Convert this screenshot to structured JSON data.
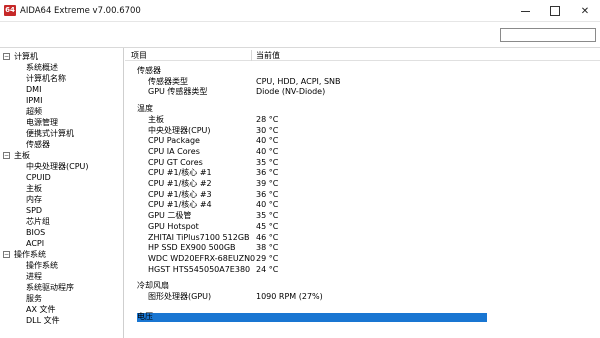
{
  "window": {
    "icon_label": "64",
    "title": "AIDA64 Extreme v7.00.6700",
    "controls": [
      "minimize",
      "maximize",
      "close"
    ]
  },
  "toolbar": {
    "search_value": ""
  },
  "tree": {
    "groups": [
      {
        "label": "计算机",
        "expander": "−",
        "items": [
          "系统概述",
          "计算机名称",
          "DMI",
          "IPMI",
          "超频",
          "电源管理",
          "便携式计算机",
          "传感器"
        ]
      },
      {
        "label": "主板",
        "expander": "−",
        "items": [
          "中央处理器(CPU)",
          "CPUID",
          "主板",
          "内存",
          "SPD",
          "芯片组",
          "BIOS",
          "ACPI"
        ]
      },
      {
        "label": "操作系统",
        "expander": "−",
        "items": [
          "操作系统",
          "进程",
          "系统驱动程序",
          "服务",
          "AX 文件",
          "DLL 文件"
        ]
      }
    ]
  },
  "table": {
    "headers": [
      "项目",
      "当前值"
    ],
    "sections": [
      {
        "title": "传感器",
        "rows": [
          [
            "传感器类型",
            "CPU, HDD, ACPI, SNB"
          ],
          [
            "GPU 传感器类型",
            "Diode  (NV-Diode)"
          ]
        ]
      },
      {
        "title": "温度",
        "rows": [
          [
            "主板",
            "28 °C"
          ],
          [
            "中央处理器(CPU)",
            "30 °C"
          ],
          [
            "CPU Package",
            "40 °C"
          ],
          [
            "CPU IA Cores",
            "40 °C"
          ],
          [
            "CPU GT Cores",
            "35 °C"
          ],
          [
            "CPU #1/核心 #1",
            "36 °C"
          ],
          [
            "CPU #1/核心 #2",
            "39 °C"
          ],
          [
            "CPU #1/核心 #3",
            "36 °C"
          ],
          [
            "CPU #1/核心 #4",
            "40 °C"
          ],
          [
            "GPU 二极管",
            "35 °C"
          ],
          [
            "GPU Hotspot",
            "45 °C"
          ],
          [
            "ZHITAI TiPlus7100 512GB",
            "46 °C"
          ],
          [
            "HP SSD EX900 500GB",
            "38 °C"
          ],
          [
            "WDC WD20EFRX-68EUZN0",
            "29 °C"
          ],
          [
            "HGST HTS545050A7E380",
            "24 °C"
          ]
        ]
      },
      {
        "title": "冷却风扇",
        "rows": [
          [
            "图形处理器(GPU)",
            "1090 RPM  (27%)"
          ]
        ]
      },
      {
        "title": "电压",
        "rows": []
      }
    ]
  },
  "colors": {
    "selection": "#1976d2",
    "app_icon": "#c62828"
  }
}
